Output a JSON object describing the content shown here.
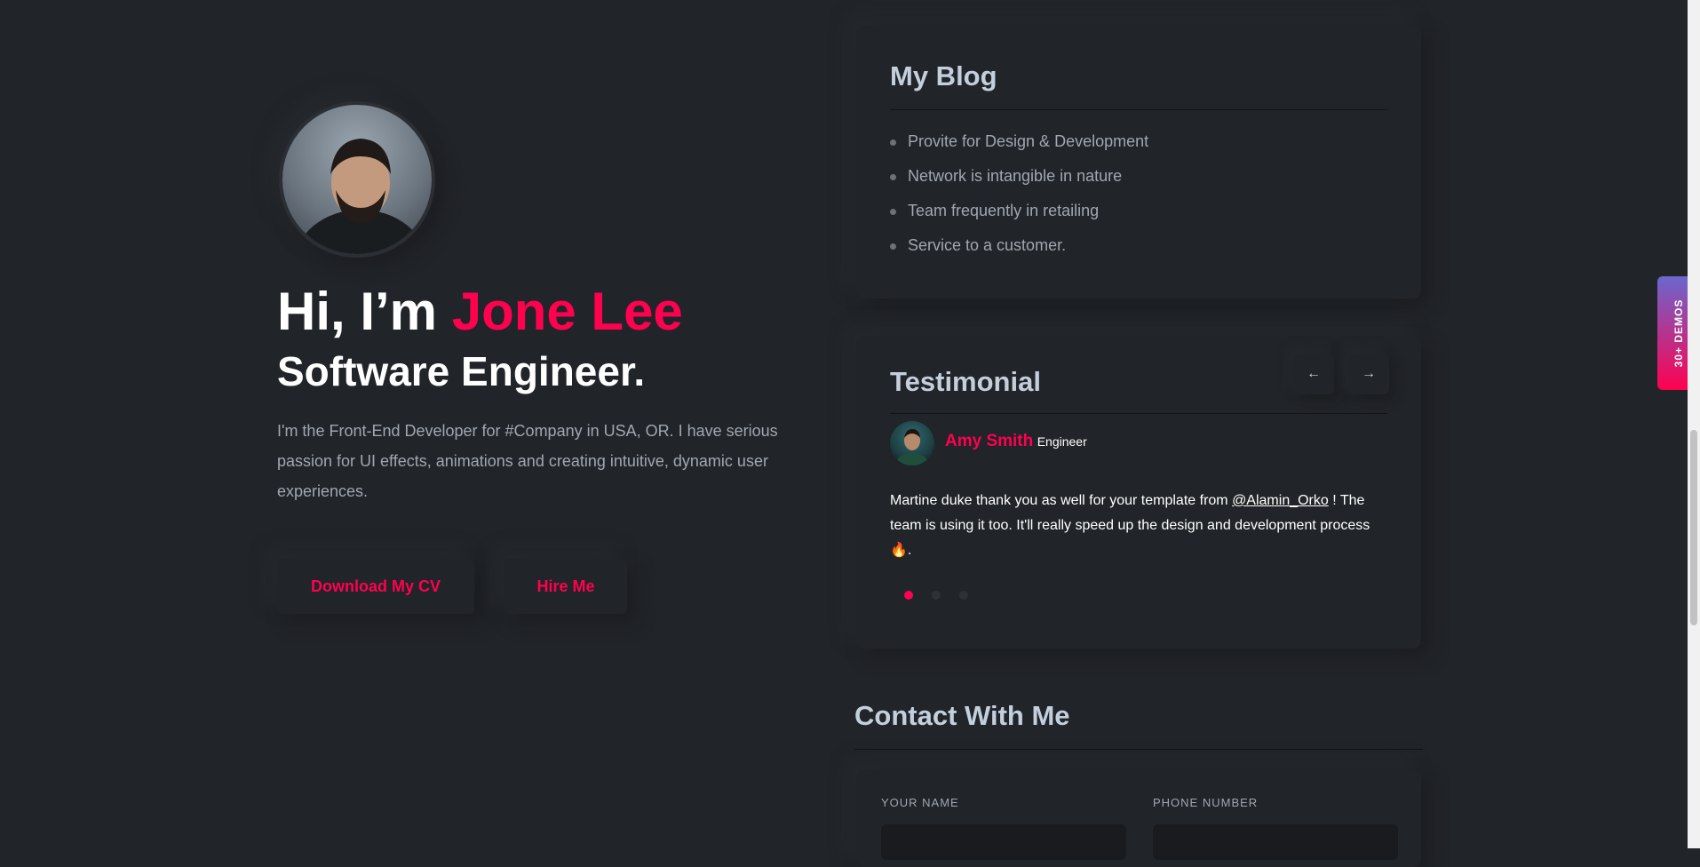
{
  "hero": {
    "greeting": "Hi, I’m ",
    "name": "Jone Lee",
    "role": "Software Engineer.",
    "description": "I'm the Front-End Developer for #Company in USA, OR. I have serious passion for UI effects, animations and creating intuitive, dynamic user experiences.",
    "buttons": {
      "download": "Download My CV",
      "hire": "Hire Me"
    }
  },
  "blog": {
    "title": "My Blog",
    "items": [
      "Provite for Design & Development",
      "Network is intangible in nature",
      "Team frequently in retailing",
      "Service to a customer."
    ]
  },
  "testimonial": {
    "title": "Testimonial",
    "prev_icon": "←",
    "next_icon": "→",
    "author": "Amy Smith",
    "author_role": "Engineer",
    "text_before": "Martine duke thank you as well for your template from ",
    "handle": "@Alamin_Orko",
    "text_after": " ! The team is using it too. It'll really speed up the design and development process 🔥.",
    "dots": 3,
    "active_dot": 0
  },
  "contact": {
    "title": "Contact With Me",
    "name_label": "YOUR NAME",
    "phone_label": "PHONE NUMBER"
  },
  "demos_tab": "30+ DEMOS",
  "colors": {
    "accent": "#ff014f",
    "background": "#212428",
    "heading": "#c4cfde",
    "body_text": "#a0a7b1"
  }
}
